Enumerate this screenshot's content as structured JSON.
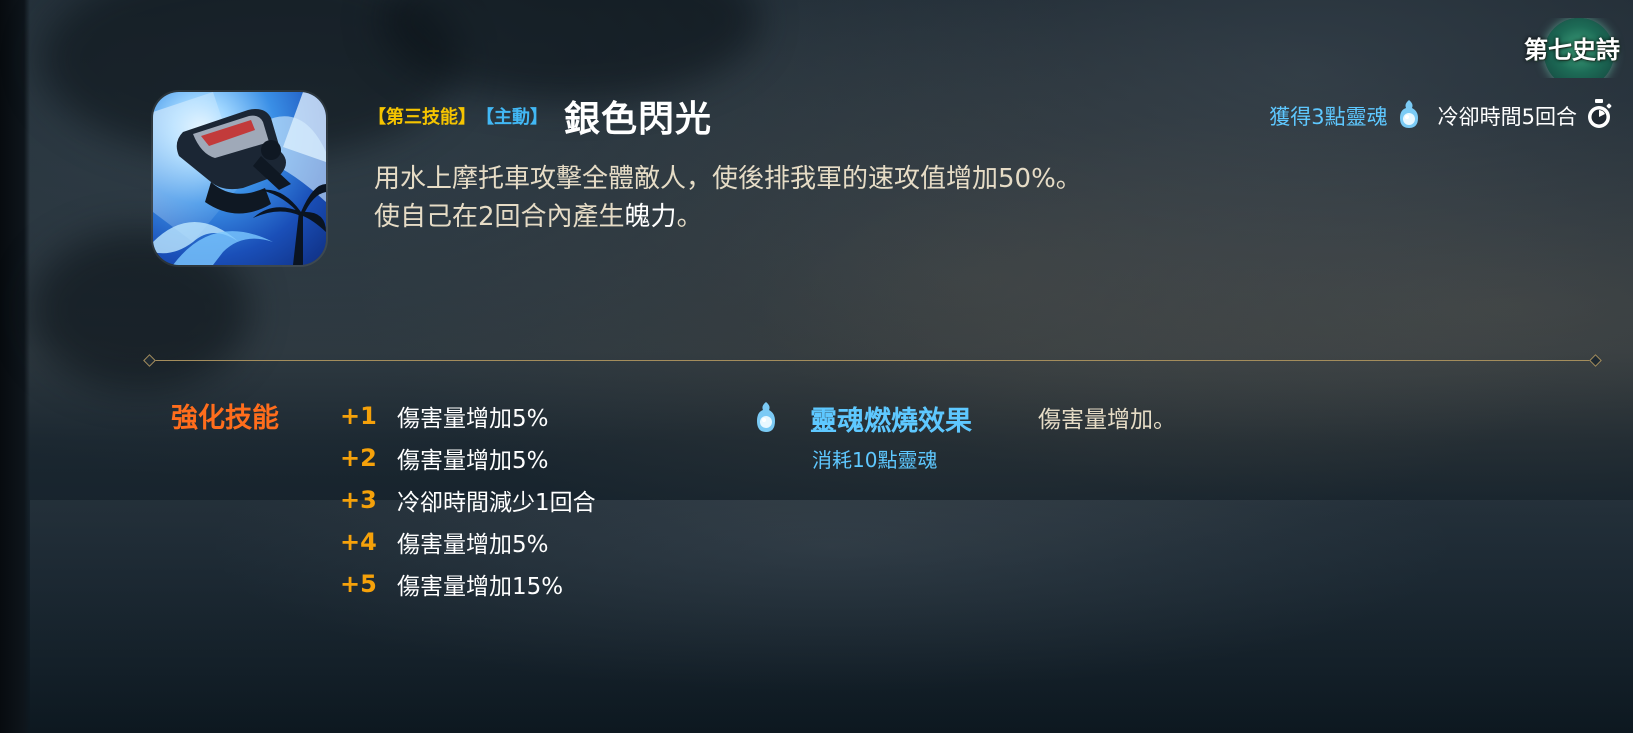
{
  "skill": {
    "tag_third": "【第三技能】",
    "tag_active": "【主動】",
    "name": "銀色閃光",
    "description_line1": "用水上摩托車攻擊全體敵人，使後排我軍的速攻值增加50%。",
    "description_line2_prefix": "使自己在2回合內產生",
    "description_line2_highlight": "魄力",
    "description_line2_suffix": "。",
    "soul_gain": "獲得3點靈魂",
    "cooldown": "冷卻時間5回合",
    "icon": "jet-ski-skill-icon"
  },
  "emblem": {
    "text": "第七史詩"
  },
  "upgrades": {
    "label": "強化技能",
    "items": [
      {
        "level": "+1",
        "text": "傷害量增加5%"
      },
      {
        "level": "+2",
        "text": "傷害量增加5%"
      },
      {
        "level": "+3",
        "text": "冷卻時間減少1回合"
      },
      {
        "level": "+4",
        "text": "傷害量增加5%"
      },
      {
        "level": "+5",
        "text": "傷害量增加15%"
      }
    ]
  },
  "soulburn": {
    "title": "靈魂燃燒效果",
    "cost": "消耗10點靈魂",
    "effect": "傷害量增加。"
  },
  "colors": {
    "tag_third": "#f5c400",
    "tag_active": "#42b8f5",
    "soul_blue": "#5ec8ff",
    "upgrade_label": "#ff6d1c",
    "upgrade_level": "#f5a10a",
    "description": "#e6dcc6",
    "divider": "#a48d5c"
  },
  "icons": {
    "soul": "soul-flame-icon",
    "cooldown": "stopwatch-icon"
  }
}
